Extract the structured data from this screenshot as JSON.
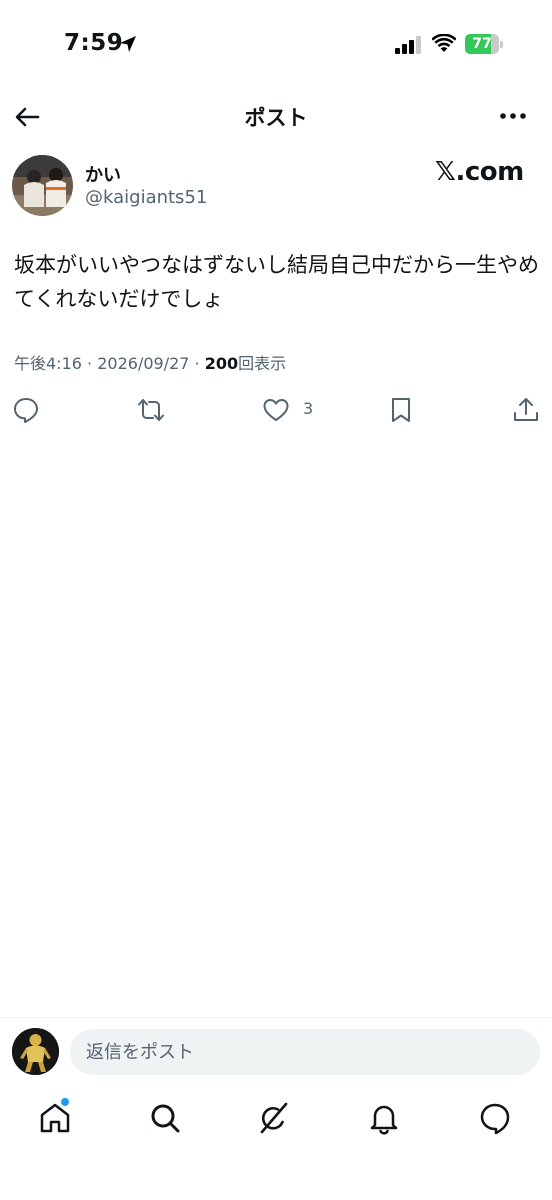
{
  "status_bar": {
    "time": "7:59",
    "battery_text": "77",
    "battery_level": 0.77,
    "battery_color": "#34c759"
  },
  "header": {
    "title": "ポスト",
    "back_icon": "arrow-left-icon",
    "more_icon": "more-horizontal-icon"
  },
  "post": {
    "author": {
      "display_name": "かい",
      "handle": "@kaigiants51"
    },
    "brand": "𝕏.com",
    "text": "坂本がいいやつなはずないし結局自己中だから一生やめてくれないだけでしょ",
    "time": "午後4:16",
    "date": "2026/09/27",
    "separator": "·",
    "views_count": "200",
    "views_label": "回表示",
    "like_count": "3"
  },
  "actions": {
    "reply_icon": "reply-icon",
    "repost_icon": "repost-icon",
    "like_icon": "heart-icon",
    "bookmark_icon": "bookmark-icon",
    "share_icon": "share-icon"
  },
  "composer": {
    "placeholder": "返信をポスト"
  },
  "bottom_nav": {
    "items": [
      "home-icon",
      "search-icon",
      "grok-icon",
      "notifications-icon",
      "messages-icon"
    ],
    "accent": "#1d9bf0"
  }
}
